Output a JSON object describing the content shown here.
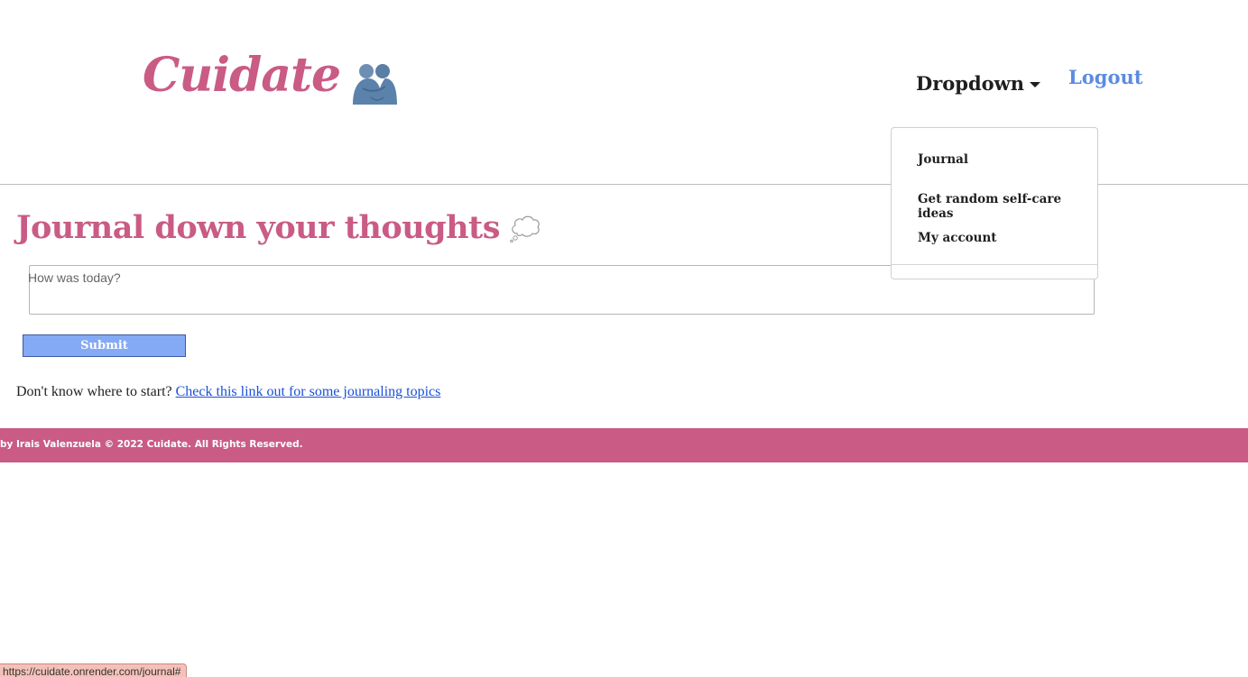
{
  "header": {
    "brand": "Cuidate",
    "dropdown_label": "Dropdown",
    "logout_label": "Logout"
  },
  "dropdown_menu": {
    "items": [
      "Journal",
      "Get random self-care ideas",
      "My account"
    ]
  },
  "main": {
    "title": "Journal down your thoughts",
    "journal_placeholder": "How was today?",
    "submit_label": "Submit",
    "help_prefix": "Don't know where to start?",
    "help_link": "Check this link out for some journaling topics"
  },
  "footer": {
    "text": "by Irais Valenzuela © 2022 Cuidate. All Rights Reserved."
  },
  "status_bar": {
    "url": "https://cuidate.onrender.com/journal#"
  },
  "colors": {
    "brand": "#c95b85",
    "link_blue": "#5b8ce0",
    "button": "#84a9f5",
    "footer": "#c95b85"
  },
  "icons": {
    "brand": "people-hugging-icon",
    "title": "thought-balloon-icon",
    "dropdown": "caret-down-icon"
  }
}
